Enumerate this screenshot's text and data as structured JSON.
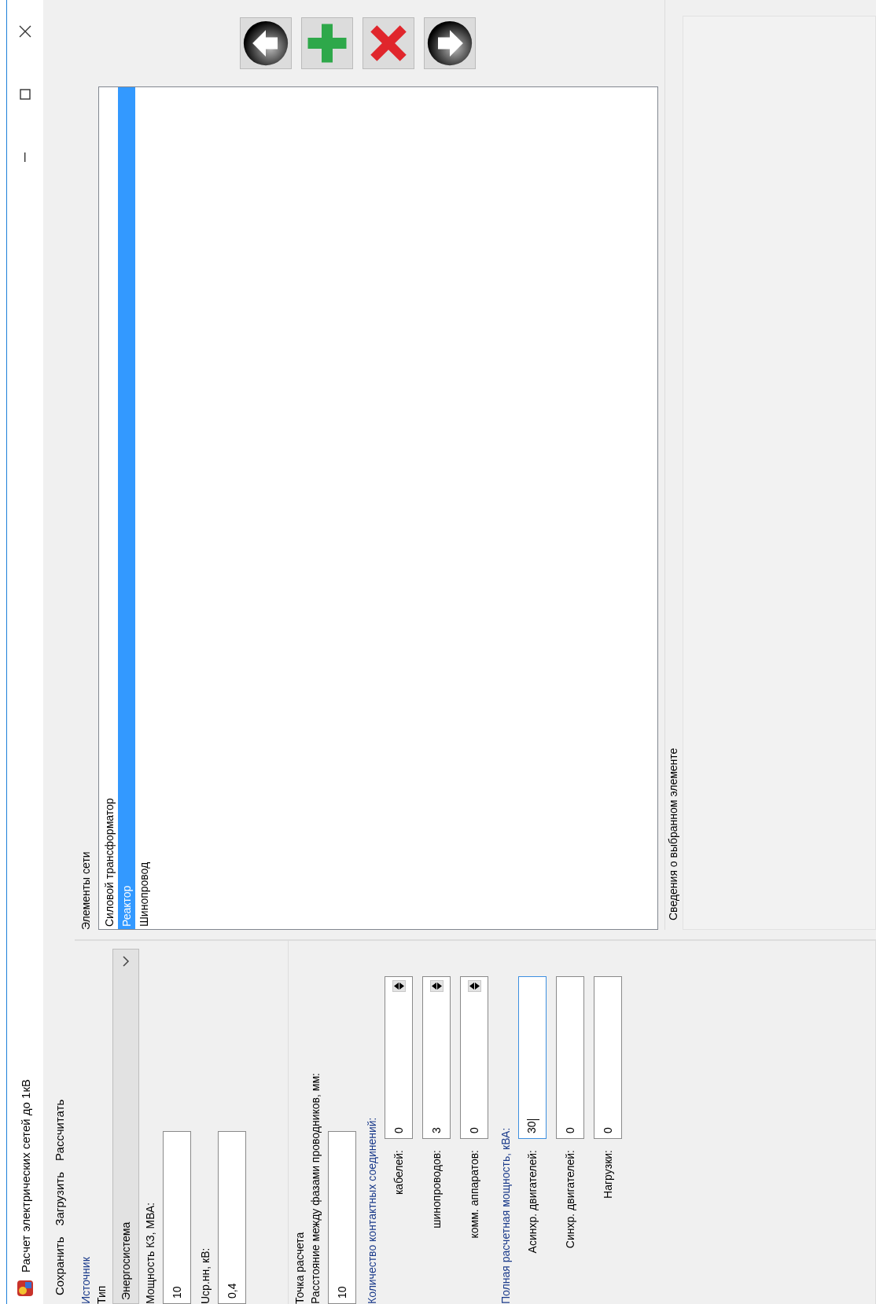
{
  "window": {
    "title": "Расчет электрических сетей до 1кВ"
  },
  "menu": [
    "Сохранить",
    "Загрузить",
    "Рассчитать"
  ],
  "source": {
    "title": "Источник",
    "type_label": "Тип",
    "type_value": "Энергосистема",
    "fields": [
      {
        "label": "Мощность КЗ, МВА:",
        "value": "10"
      },
      {
        "label": "Uср.нн, кВ:",
        "value": "0,4"
      }
    ]
  },
  "calc_point": {
    "title": "Точка расчета",
    "distance": {
      "label": "Расстояние между фазами проводников, мм:",
      "value": "10"
    },
    "contacts": {
      "label": "Количество контактных соединений:",
      "rows": [
        {
          "label": "кабелей:",
          "value": "0"
        },
        {
          "label": "шинопроводов:",
          "value": "3"
        },
        {
          "label": "комм. аппаратов:",
          "value": "0"
        }
      ]
    },
    "power": {
      "label": "Полная расчетная мощность, кВА:",
      "rows": [
        {
          "label": "Асинхр. двигателей:",
          "value": "30",
          "focused": true
        },
        {
          "label": "Синхр. двигателей:",
          "value": "0",
          "focused": false
        },
        {
          "label": "Нагрузки:",
          "value": "0",
          "focused": false
        }
      ]
    }
  },
  "elements": {
    "title": "Элементы сети",
    "items": [
      {
        "label": "Силовой трансформатор",
        "selected": false
      },
      {
        "label": "Реактор",
        "selected": true
      },
      {
        "label": "Шинопровод",
        "selected": false
      }
    ]
  },
  "toolbar": [
    {
      "kind": "back"
    },
    {
      "kind": "add"
    },
    {
      "kind": "delete"
    },
    {
      "kind": "forward"
    }
  ],
  "info": {
    "title": "Сведения о выбранном элементе"
  }
}
